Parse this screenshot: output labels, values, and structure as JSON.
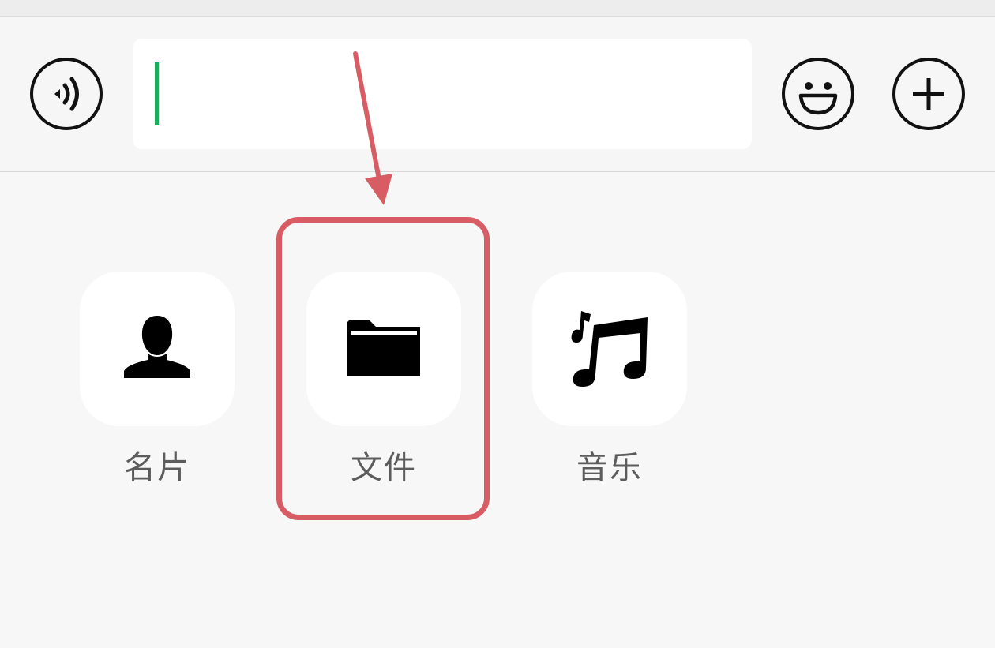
{
  "input_bar": {
    "voice_icon": "voice-waves-icon",
    "emoji_icon": "smiley-face-icon",
    "plus_icon": "plus-icon",
    "text_value": ""
  },
  "panel": {
    "items": [
      {
        "label": "名片",
        "icon": "person-icon"
      },
      {
        "label": "文件",
        "icon": "folder-icon"
      },
      {
        "label": "音乐",
        "icon": "music-note-icon"
      }
    ]
  },
  "annotation": {
    "highlight_color": "#d85c64",
    "caret_color": "#1aad5a"
  }
}
